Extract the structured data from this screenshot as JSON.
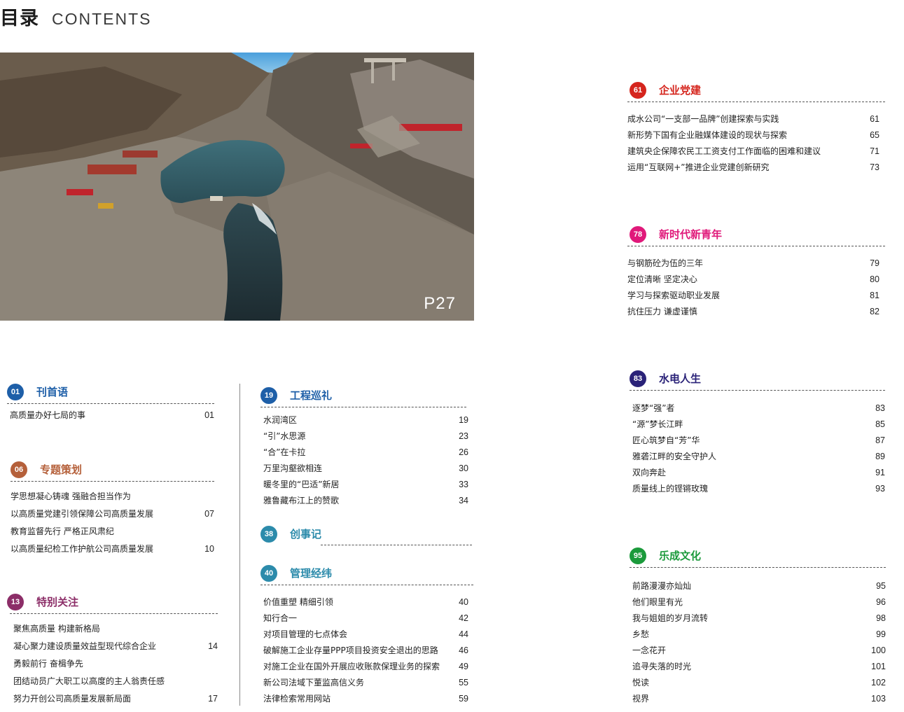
{
  "header": {
    "title_cn": "目录",
    "title_en": "CONTENTS"
  },
  "photo": {
    "page_label": "P27"
  },
  "colors": {
    "red": "#d5251d",
    "pink": "#e0197a",
    "navy": "#2a2278",
    "green": "#1b9a3b",
    "blue": "#1e5fa8",
    "brown": "#b5603a",
    "plum": "#8c2e68",
    "teal": "#2c8bab"
  },
  "sections": {
    "s01": {
      "num": "01",
      "title": "刊首语",
      "items": [
        {
          "text": "高质量办好七局的事",
          "page": "01"
        }
      ]
    },
    "s06": {
      "num": "06",
      "title": "专题策划",
      "items": [
        {
          "text": "学思想凝心铸魂  强融合担当作为",
          "page": ""
        },
        {
          "text": "以高质量党建引领保障公司高质量发展",
          "page": "07"
        },
        {
          "text": "教育监督先行  严格正风肃纪",
          "page": ""
        },
        {
          "text": "以高质量纪检工作护航公司高质量发展",
          "page": "10"
        }
      ]
    },
    "s13": {
      "num": "13",
      "title": "特别关注",
      "items": [
        {
          "text": "聚焦高质量  构建新格局",
          "page": ""
        },
        {
          "text": "凝心聚力建设质量效益型现代综合企业",
          "page": "14"
        },
        {
          "text": "勇毅前行  奋楫争先",
          "page": ""
        },
        {
          "text": "团结动员广大职工以高度的主人翁责任感",
          "page": ""
        },
        {
          "text": "努力开创公司高质量发展新局面",
          "page": "17"
        }
      ]
    },
    "s19": {
      "num": "19",
      "title": "工程巡礼",
      "items": [
        {
          "text": "水润湾区",
          "page": "19"
        },
        {
          "text": "“引”水思源",
          "page": "23"
        },
        {
          "text": "“合”在卡拉",
          "page": "26"
        },
        {
          "text": "万里沟壑欲相连",
          "page": "30"
        },
        {
          "text": "暖冬里的“巴适”新居",
          "page": "33"
        },
        {
          "text": "雅鲁藏布江上的赞歌",
          "page": "34"
        }
      ]
    },
    "s38": {
      "num": "38",
      "title": "创事记",
      "items": []
    },
    "s40": {
      "num": "40",
      "title": "管理经纬",
      "items": [
        {
          "text": "价值重塑  精细引领",
          "page": "40"
        },
        {
          "text": "知行合一",
          "page": "42"
        },
        {
          "text": "对项目管理的七点体会",
          "page": "44"
        },
        {
          "text": "破解施工企业存量PPP项目投资安全退出的思路",
          "page": "46"
        },
        {
          "text": "对施工企业在国外开展应收账款保理业务的探索",
          "page": "49"
        },
        {
          "text": "新公司法域下董监高信义务",
          "page": "55"
        },
        {
          "text": "法律检索常用网站",
          "page": "59"
        }
      ]
    },
    "s61": {
      "num": "61",
      "title": "企业党建",
      "items": [
        {
          "text": "成水公司“一支部一品牌”创建探索与实践",
          "page": "61"
        },
        {
          "text": "新形势下国有企业融媒体建设的现状与探索",
          "page": "65"
        },
        {
          "text": "建筑央企保障农民工工资支付工作面临的困难和建议",
          "page": "71"
        },
        {
          "text": "运用“互联网+”推进企业党建创新研究",
          "page": "73"
        }
      ]
    },
    "s78": {
      "num": "78",
      "title": "新时代新青年",
      "items": [
        {
          "text": "与钢筋砼为伍的三年",
          "page": "79"
        },
        {
          "text": "定位清晰  坚定决心",
          "page": "80"
        },
        {
          "text": "学习与探索驱动职业发展",
          "page": "81"
        },
        {
          "text": "抗住压力  谦虚谨慎",
          "page": "82"
        }
      ]
    },
    "s83": {
      "num": "83",
      "title": "水电人生",
      "items": [
        {
          "text": "逐梦“强”者",
          "page": "83"
        },
        {
          "text": "“源”梦长江畔",
          "page": "85"
        },
        {
          "text": "匠心筑梦自“芳”华",
          "page": "87"
        },
        {
          "text": "雅砻江畔的安全守护人",
          "page": "89"
        },
        {
          "text": "双向奔赴",
          "page": "91"
        },
        {
          "text": "质量线上的铿锵玫瑰",
          "page": "93"
        }
      ]
    },
    "s95": {
      "num": "95",
      "title": "乐成文化",
      "items": [
        {
          "text": "前路漫漫亦灿灿",
          "page": "95"
        },
        {
          "text": "他们眼里有光",
          "page": "96"
        },
        {
          "text": "我与姐姐的岁月流转",
          "page": "98"
        },
        {
          "text": "乡愁",
          "page": "99"
        },
        {
          "text": "一念花开",
          "page": "100"
        },
        {
          "text": "追寻失落的时光",
          "page": "101"
        },
        {
          "text": "悦读",
          "page": "102"
        },
        {
          "text": "视界",
          "page": "103"
        }
      ]
    }
  }
}
